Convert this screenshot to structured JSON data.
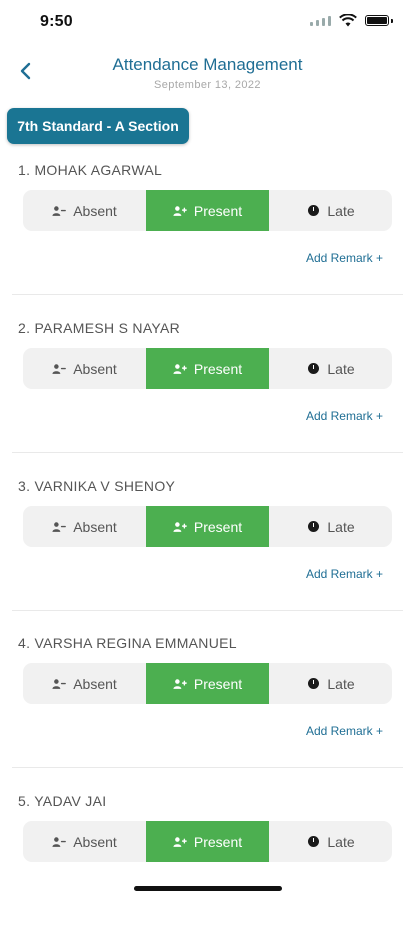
{
  "status": {
    "time": "9:50"
  },
  "header": {
    "title": "Attendance Management",
    "date": "September 13, 2022"
  },
  "section": {
    "label": "7th Standard - A Section"
  },
  "options": {
    "absent": "Absent",
    "present": "Present",
    "late": "Late"
  },
  "remark_label": "Add Remark +",
  "students": [
    {
      "name": "1. MOHAK AGARWAL",
      "status": "Present"
    },
    {
      "name": "2. PARAMESH S NAYAR",
      "status": "Present"
    },
    {
      "name": "3. VARNIKA V SHENOY",
      "status": "Present"
    },
    {
      "name": "4. VARSHA REGINA EMMANUEL",
      "status": "Present"
    },
    {
      "name": "5. YADAV JAI",
      "status": "Present"
    }
  ],
  "colors": {
    "accent": "#1f6e94",
    "chip": "#1a7593",
    "present": "#4caf50"
  },
  "icons": [
    "back-icon",
    "person-minus-icon",
    "person-plus-icon",
    "clock-icon",
    "signal-icon",
    "wifi-icon",
    "battery-icon"
  ]
}
